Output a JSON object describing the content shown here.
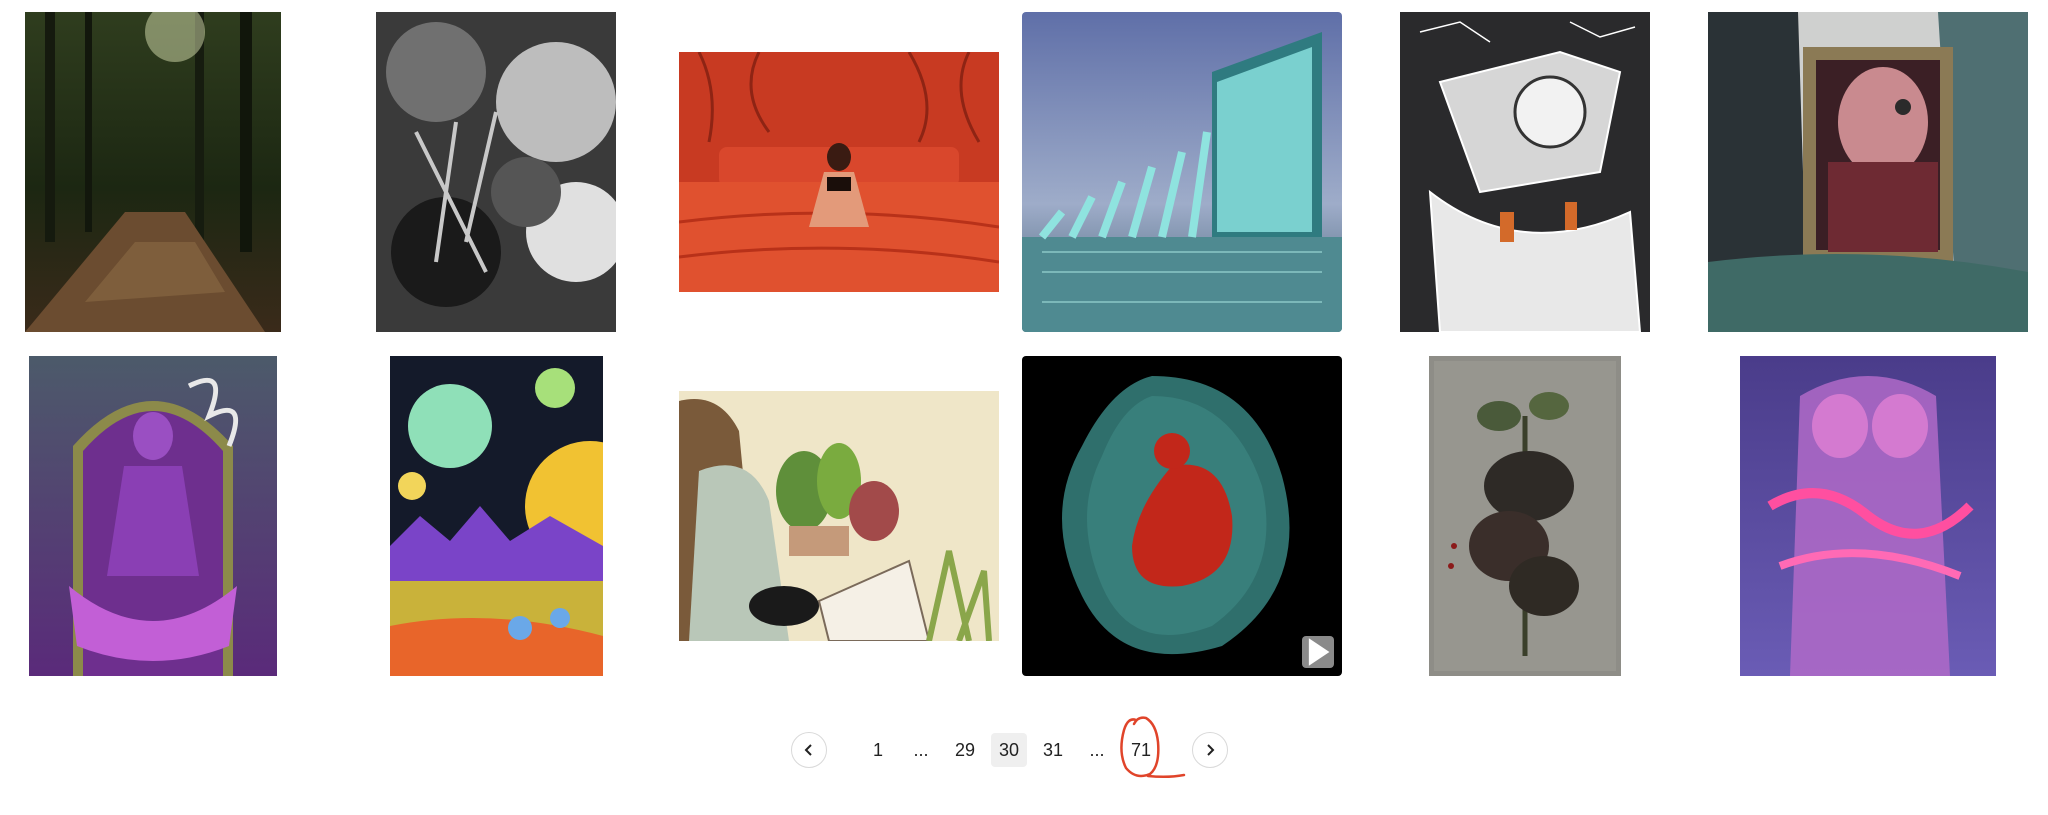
{
  "gallery": {
    "items": [
      {
        "name": "forest-path-artwork"
      },
      {
        "name": "black-white-foliage-artwork"
      },
      {
        "name": "woman-on-red-bed-artwork"
      },
      {
        "name": "glass-pavilion-on-water-artwork"
      },
      {
        "name": "surreal-ink-machine-artwork"
      },
      {
        "name": "melting-portrait-frame-artwork"
      },
      {
        "name": "purple-goddess-lotus-artwork"
      },
      {
        "name": "psychedelic-moon-astronauts-artwork"
      },
      {
        "name": "girl-reading-with-plants-artwork"
      },
      {
        "name": "red-fetus-in-teal-artwork"
      },
      {
        "name": "dark-flowering-plant-artwork"
      },
      {
        "name": "pink-smoke-figures-artwork"
      }
    ],
    "video_badge_icon": "play-icon"
  },
  "pagination": {
    "prev_icon": "chevron-left-icon",
    "next_icon": "chevron-right-icon",
    "pages": [
      "1",
      "...",
      "29",
      "30",
      "31",
      "...",
      "71"
    ],
    "current": "30",
    "annotation_color": "#e0442a"
  }
}
